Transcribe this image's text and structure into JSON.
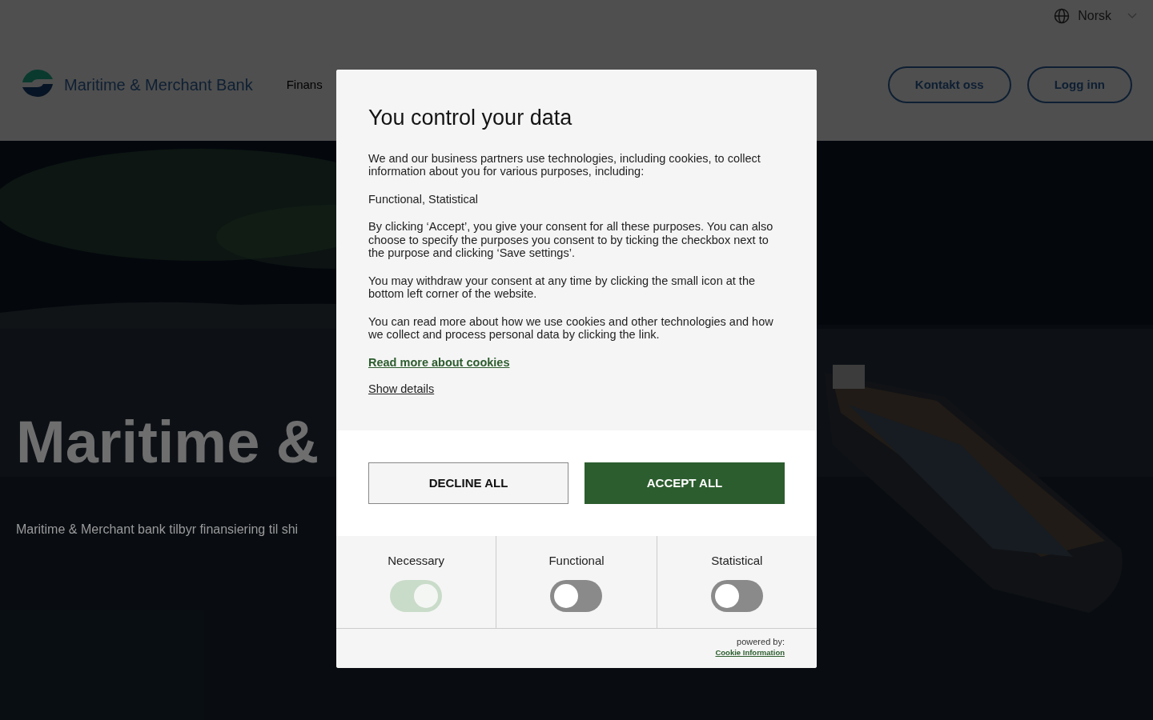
{
  "language_selector": {
    "label": "Norsk"
  },
  "header": {
    "brand": "Maritime & Merchant Bank",
    "nav_items": [
      "Finans"
    ],
    "buttons": [
      "Kontakt oss",
      "Logg inn"
    ]
  },
  "hero": {
    "title": "Maritime &",
    "subtitle": "Maritime & Merchant bank tilbyr finansiering til shi"
  },
  "cookie_dialog": {
    "title": "You control your data",
    "paragraphs": [
      "We and our business partners use technologies, including cookies, to collect information about you for various purposes, including:",
      "Functional, Statistical",
      "By clicking ‘Accept’, you give your consent for all these purposes. You can also choose to specify the purposes you consent to by ticking the checkbox next to the purpose and clicking ‘Save settings’.",
      "You may withdraw your consent at any time by clicking the small icon at the bottom left corner of the website.",
      "You can read more about how we use cookies and other technologies and how we collect and process personal data by clicking the link."
    ],
    "read_more_link": "Read more about cookies",
    "show_details_link": "Show details",
    "buttons": [
      {
        "label": "DECLINE ALL",
        "kind": "secondary"
      },
      {
        "label": "ACCEPT ALL",
        "kind": "primary"
      }
    ],
    "purposes": [
      {
        "label": "Necessary",
        "checked": true,
        "disabled": true
      },
      {
        "label": "Functional",
        "checked": false,
        "disabled": false
      },
      {
        "label": "Statistical",
        "checked": false,
        "disabled": false
      }
    ],
    "powered_by": "powered by:",
    "provider_link": "Cookie Information"
  }
}
